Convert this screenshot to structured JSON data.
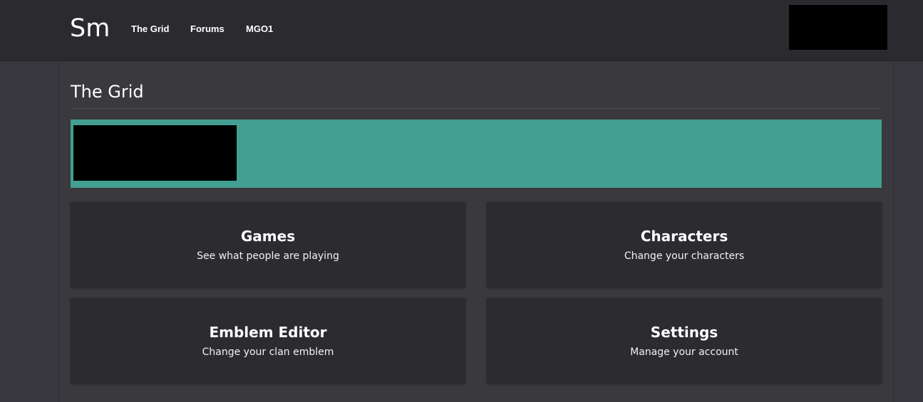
{
  "navbar": {
    "brand": "Sm",
    "links": [
      "The Grid",
      "Forums",
      "MGO1"
    ]
  },
  "page": {
    "title": "The Grid"
  },
  "cards": [
    {
      "title": "Games",
      "description": "See what people are playing"
    },
    {
      "title": "Characters",
      "description": "Change your characters"
    },
    {
      "title": "Emblem Editor",
      "description": "Change your clan emblem"
    },
    {
      "title": "Settings",
      "description": "Manage your account"
    }
  ],
  "colors": {
    "navbar_bg": "#2b2a2f",
    "page_bg": "#38373d",
    "banner": "#439f91",
    "card_bg": "#2c2b30",
    "redacted": "#000000"
  }
}
